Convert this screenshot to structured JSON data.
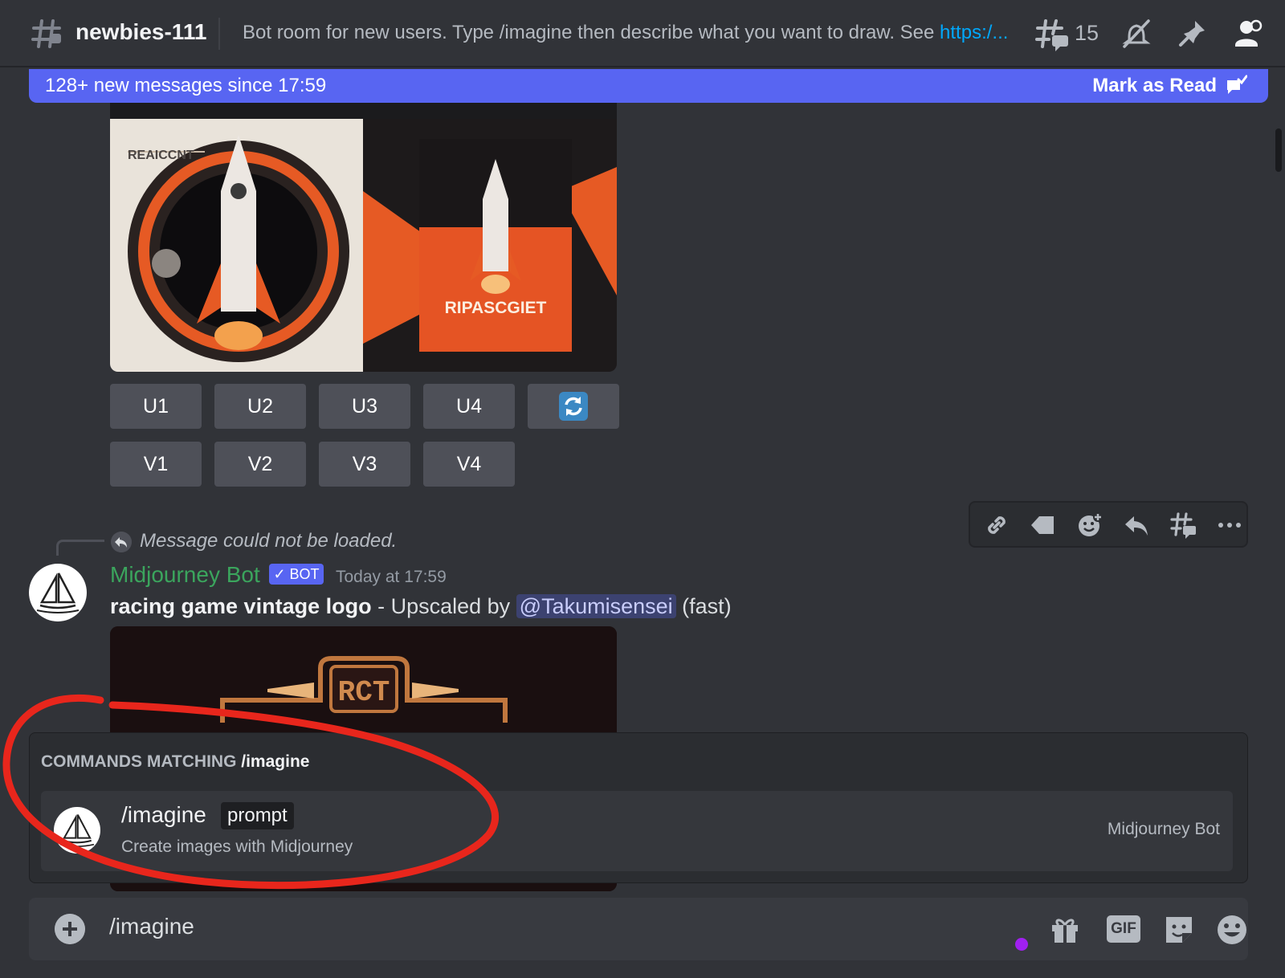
{
  "channel": {
    "name": "newbies-111",
    "topic_text": "Bot room for new users. Type /imagine then describe what you want to draw. See ",
    "topic_link": "https:/...",
    "thread_count": "15"
  },
  "banner": {
    "text": "128+ new messages since 17:59",
    "mark_read": "Mark as Read"
  },
  "grid_images": {
    "left_title": "REAICCNT",
    "right_title": "RIPASCGIET"
  },
  "upscale_buttons": [
    "U1",
    "U2",
    "U3",
    "U4"
  ],
  "variation_buttons": [
    "V1",
    "V2",
    "V3",
    "V4"
  ],
  "reply": {
    "text": "Message could not be loaded."
  },
  "message": {
    "author": "Midjourney Bot",
    "badge": "✓ BOT",
    "timestamp": "Today at 17:59",
    "prompt": "racing game vintage logo",
    "mid": " - Upscaled by ",
    "mention": "@Takumisensei",
    "suffix": " (fast)",
    "image_text": "RCT"
  },
  "command_popup": {
    "header": "COMMANDS MATCHING",
    "query": "/imagine",
    "command": "/imagine",
    "argument": "prompt",
    "description": "Create images with Midjourney",
    "bot_name": "Midjourney Bot"
  },
  "input": {
    "value": "/imagine",
    "gif_label": "GIF"
  },
  "colors": {
    "accent": "#5865f2",
    "bot_name": "#3ba55d",
    "annotation": "#e8261c",
    "link": "#00a8fc"
  }
}
